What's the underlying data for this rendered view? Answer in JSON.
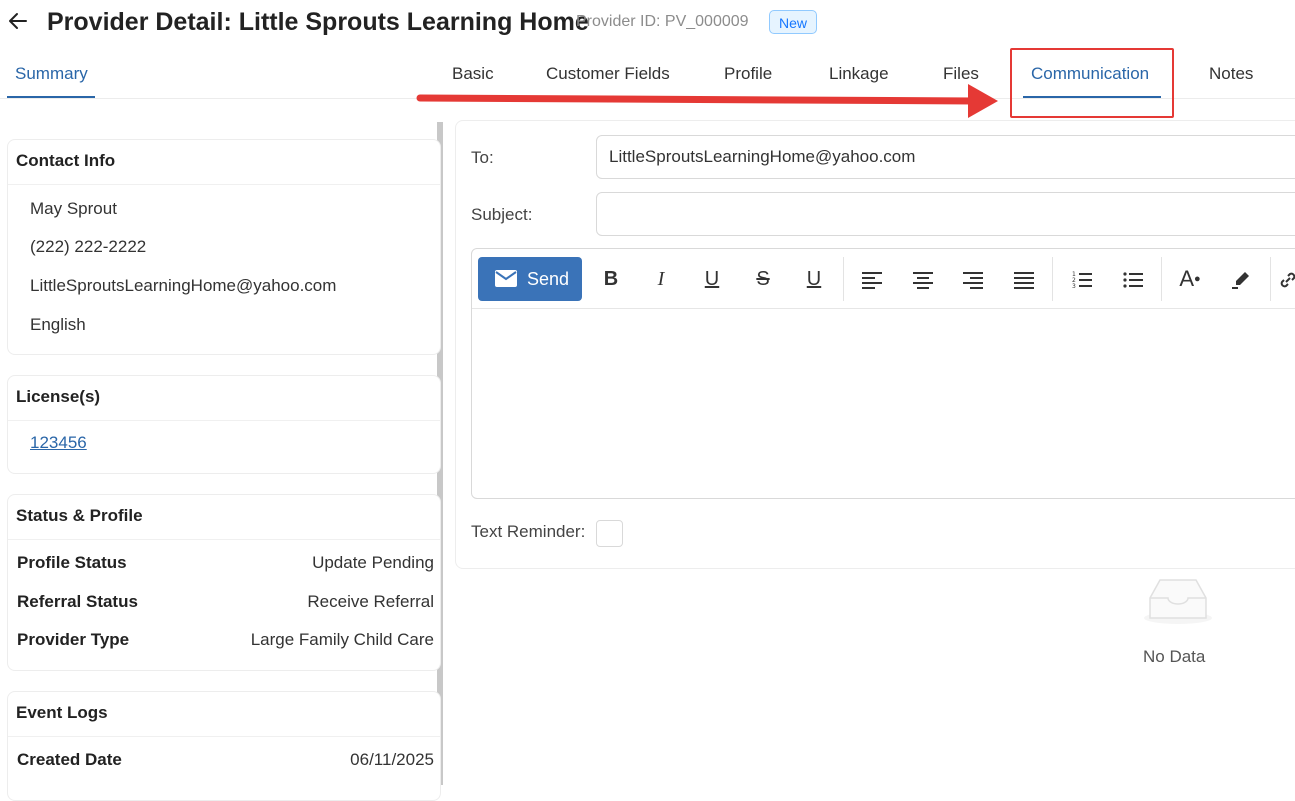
{
  "header": {
    "title": "Provider Detail: Little Sprouts Learning Home",
    "provider_id": "Provider ID: PV_000009",
    "badge": "New"
  },
  "tabs_left": [
    {
      "label": "Summary",
      "active": true
    }
  ],
  "tabs": [
    {
      "label": "Basic"
    },
    {
      "label": "Customer Fields"
    },
    {
      "label": "Profile"
    },
    {
      "label": "Linkage"
    },
    {
      "label": "Files"
    },
    {
      "label": "Communication",
      "active": true
    },
    {
      "label": "Notes"
    }
  ],
  "annotation": {
    "color": "#e53935"
  },
  "contact_info": {
    "title": "Contact Info",
    "name": "May Sprout",
    "phone": "(222) 222-2222",
    "email": "LittleSproutsLearningHome@yahoo.com",
    "language": "English"
  },
  "licenses": {
    "title": "License(s)",
    "items": [
      "123456"
    ]
  },
  "status_profile": {
    "title": "Status & Profile",
    "rows": [
      {
        "label": "Profile Status",
        "value": "Update Pending"
      },
      {
        "label": "Referral Status",
        "value": "Receive Referral"
      },
      {
        "label": "Provider Type",
        "value": "Large Family Child Care"
      }
    ]
  },
  "event_logs": {
    "title": "Event Logs",
    "rows": [
      {
        "label": "Created Date",
        "value": "06/11/2025"
      }
    ]
  },
  "communication": {
    "to_label": "To:",
    "to_value": "LittleSproutsLearningHome@yahoo.com",
    "subject_label": "Subject:",
    "subject_value": "",
    "send_label": "Send",
    "text_reminder_label": "Text Reminder:",
    "toolbar_icons": [
      "bold-icon",
      "italic-icon",
      "underline-icon",
      "strikethrough-icon",
      "underline-alt-icon",
      "align-left-icon",
      "align-center-icon",
      "align-right-icon",
      "align-justify-icon",
      "ordered-list-icon",
      "bullet-list-icon",
      "font-color-icon",
      "highlight-icon",
      "link-icon"
    ]
  },
  "empty_state": {
    "text": "No Data"
  },
  "colors": {
    "primary": "#2a66a8",
    "send": "#3a73b8",
    "highlight": "#e53935"
  }
}
